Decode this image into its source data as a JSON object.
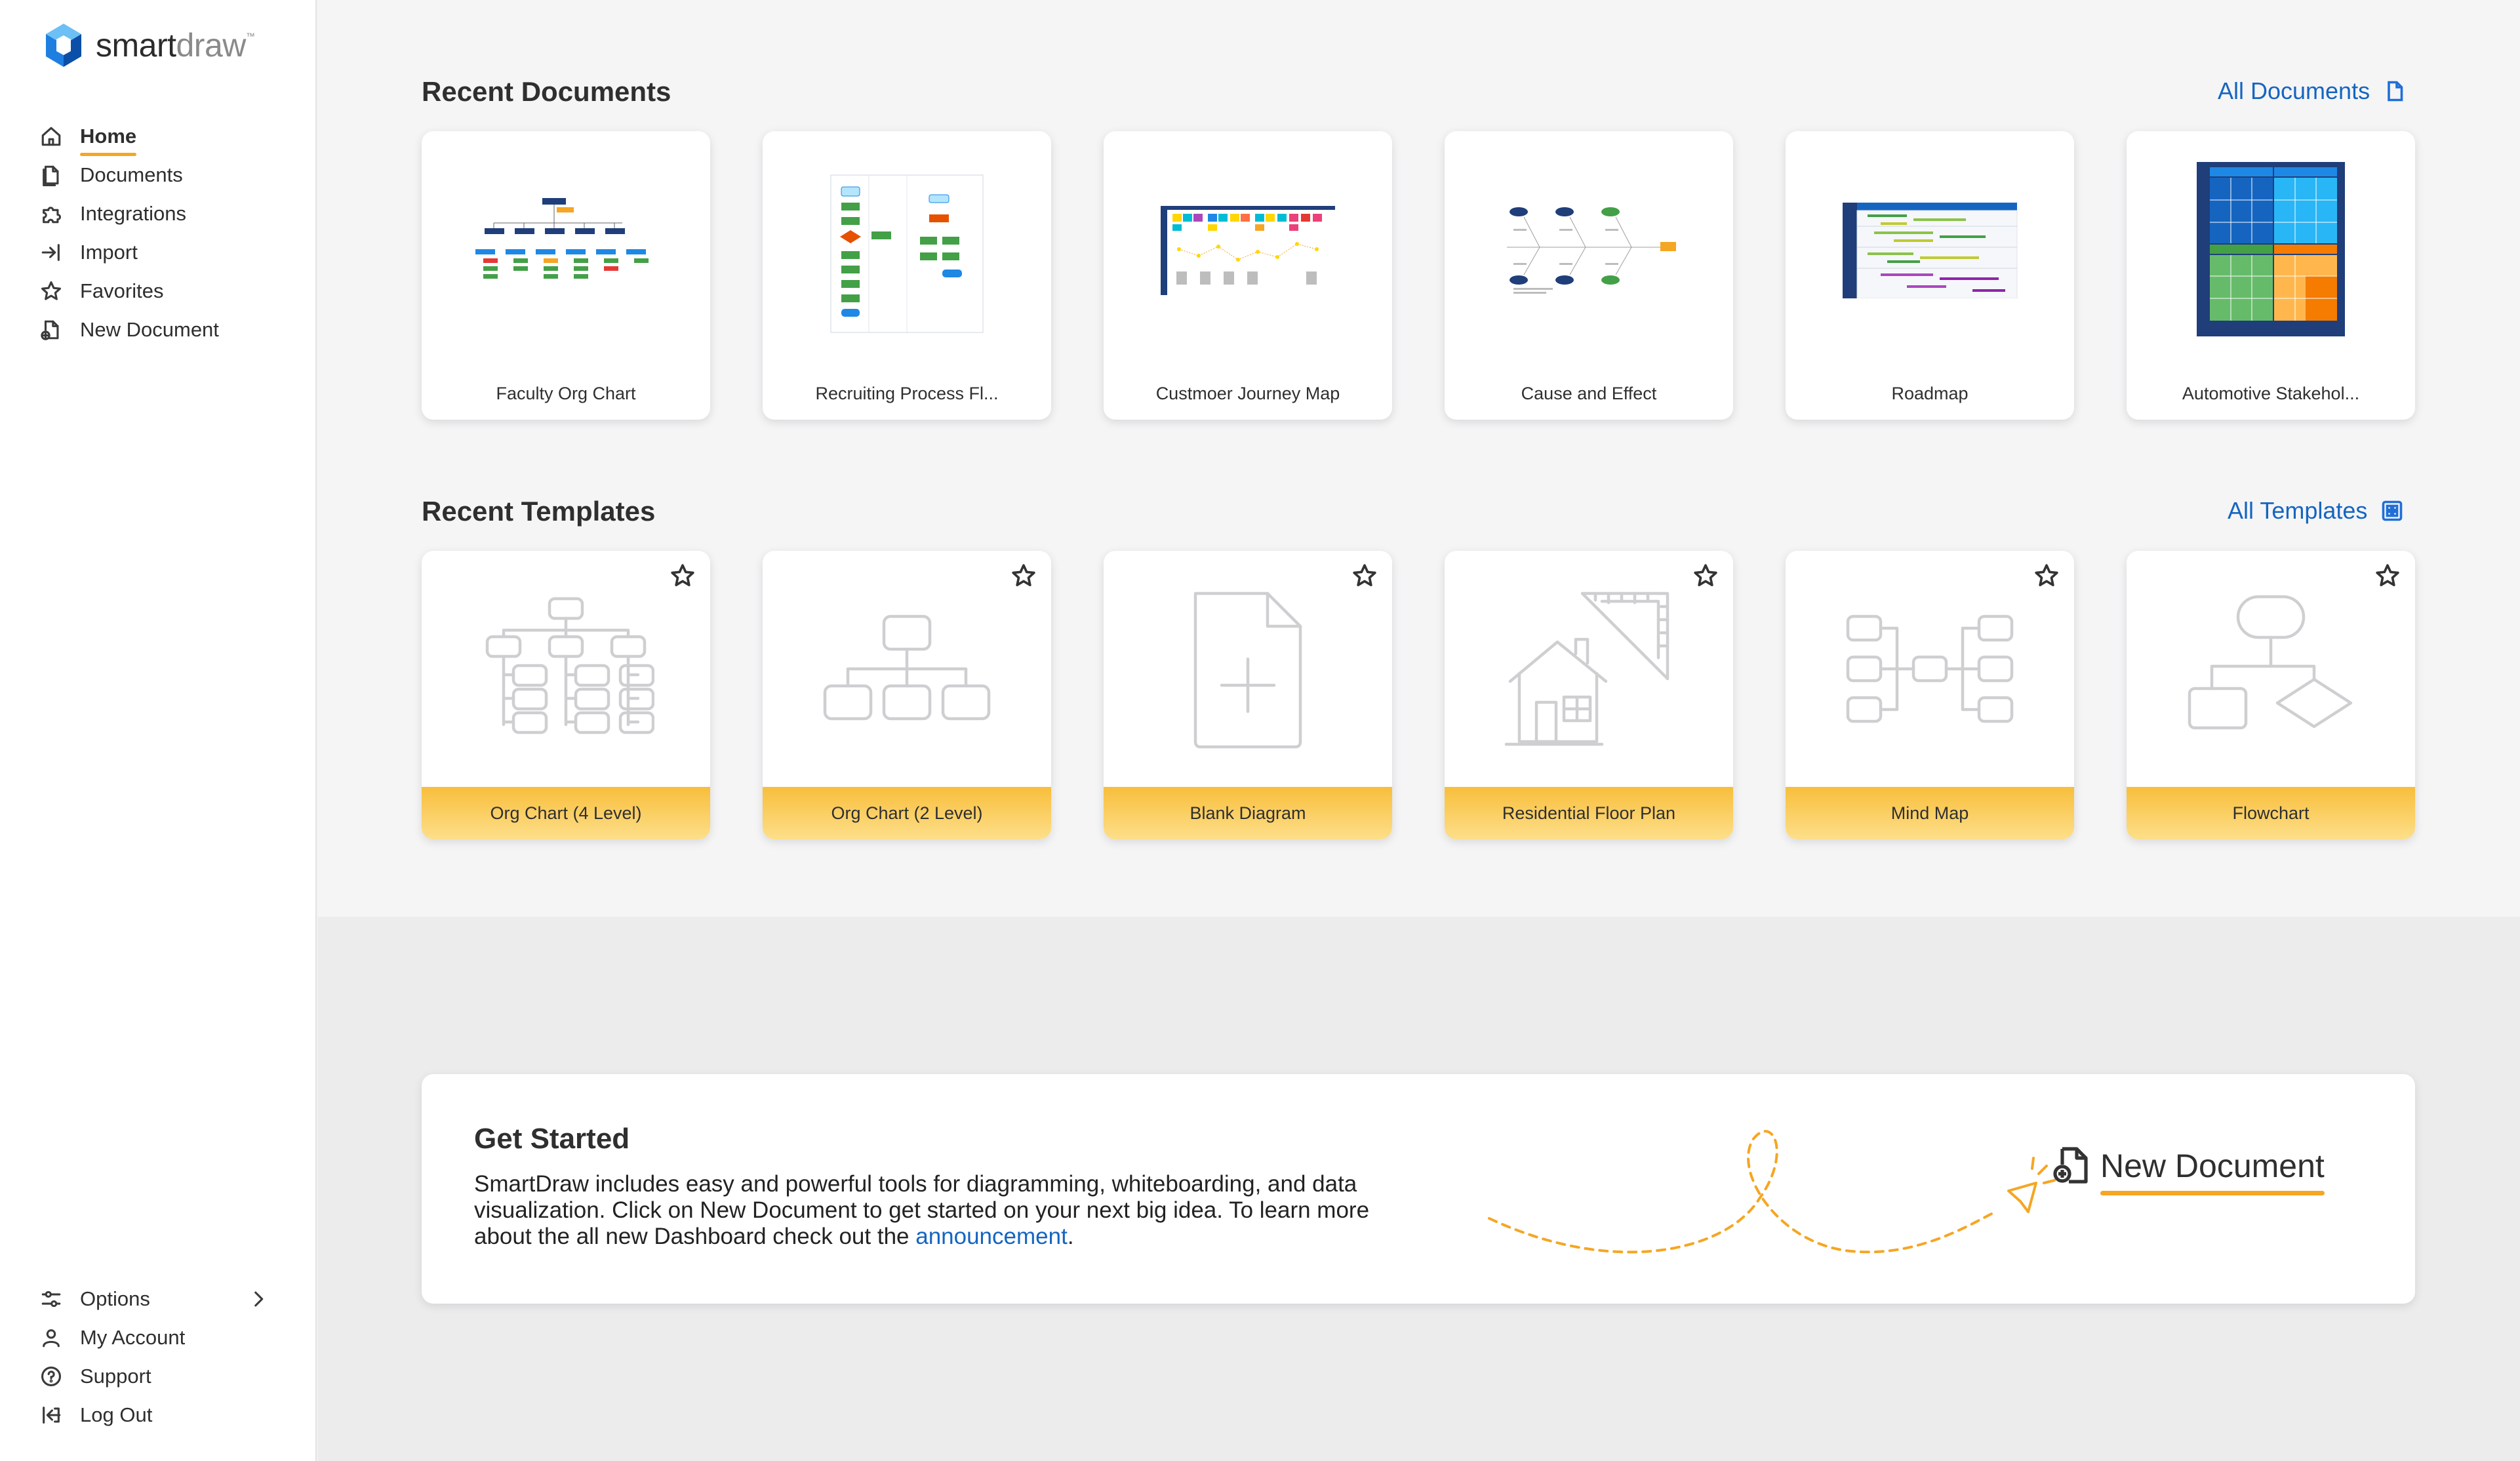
{
  "app": {
    "brand_main": "smart",
    "brand_accent": "draw",
    "brand_mark": "™"
  },
  "sidebar": {
    "items": [
      {
        "label": "Home",
        "icon": "home-icon",
        "active": true
      },
      {
        "label": "Documents",
        "icon": "documents-icon"
      },
      {
        "label": "Integrations",
        "icon": "puzzle-icon"
      },
      {
        "label": "Import",
        "icon": "import-icon"
      },
      {
        "label": "Favorites",
        "icon": "star-icon"
      },
      {
        "label": "New Document",
        "icon": "new-document-icon"
      }
    ],
    "bottom_items": [
      {
        "label": "Options",
        "icon": "sliders-icon"
      },
      {
        "label": "My Account",
        "icon": "user-icon"
      },
      {
        "label": "Support",
        "icon": "help-icon"
      },
      {
        "label": "Log Out",
        "icon": "logout-icon"
      }
    ]
  },
  "recent_documents": {
    "title": "Recent Documents",
    "link": "All Documents",
    "items": [
      {
        "label": "Faculty Org Chart"
      },
      {
        "label": "Recruiting Process Fl..."
      },
      {
        "label": "Custmoer Journey Map"
      },
      {
        "label": "Cause and Effect"
      },
      {
        "label": "Roadmap"
      },
      {
        "label": "Automotive Stakehol..."
      }
    ]
  },
  "recent_templates": {
    "title": "Recent Templates",
    "link": "All Templates",
    "items": [
      {
        "label": "Org Chart (4 Level)"
      },
      {
        "label": "Org Chart (2 Level)"
      },
      {
        "label": "Blank Diagram"
      },
      {
        "label": "Residential Floor Plan"
      },
      {
        "label": "Mind Map"
      },
      {
        "label": "Flowchart"
      }
    ]
  },
  "get_started": {
    "title": "Get Started",
    "text_before": "SmartDraw includes easy and powerful tools for diagramming, whiteboarding, and data visualization. Click on New Document to get started on your next big idea. To learn more about the all new Dashboard check out the ",
    "link": "announcement",
    "text_after": ".",
    "new_document_label": "New Document"
  },
  "colors": {
    "accent": "#f5a623",
    "link": "#1565c0",
    "brand_blue": "#1e7fe0"
  }
}
